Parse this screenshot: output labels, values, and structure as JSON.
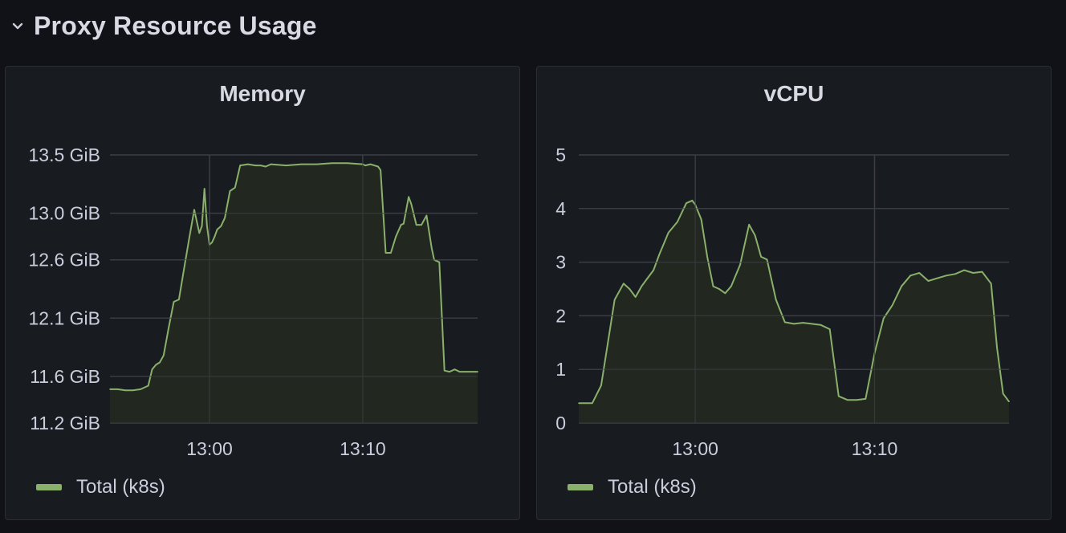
{
  "row": {
    "title": "Proxy Resource Usage",
    "icon": "chevron-down-icon"
  },
  "colors": {
    "series": "#8ab06b",
    "fill": "#242a20",
    "grid": "#3a3d44",
    "text": "#ccccdc"
  },
  "legend_label": "Total (k8s)",
  "chart_data": [
    {
      "type": "area",
      "title": "Memory",
      "ylabel": "",
      "xlabel": "",
      "unit": "GiB",
      "ylim": [
        11.2,
        13.5
      ],
      "y_ticks": [
        {
          "value": 13.5,
          "label": "13.5 GiB"
        },
        {
          "value": 13.0,
          "label": "13.0 GiB"
        },
        {
          "value": 12.6,
          "label": "12.6 GiB"
        },
        {
          "value": 12.1,
          "label": "12.1 GiB"
        },
        {
          "value": 11.6,
          "label": "11.6 GiB"
        },
        {
          "value": 11.2,
          "label": "11.2 GiB"
        }
      ],
      "xlim": [
        "12:53:30",
        "13:17:30"
      ],
      "x_ticks": [
        {
          "value": "13:00",
          "label": "13:00"
        },
        {
          "value": "13:10",
          "label": "13:10"
        }
      ],
      "grid": true,
      "legend_position": "bottom-left",
      "series": [
        {
          "name": "Total (k8s)",
          "x": [
            "12:53:30",
            "12:54:00",
            "12:54:30",
            "12:55:00",
            "12:55:30",
            "12:56:00",
            "12:56:15",
            "12:56:30",
            "12:56:45",
            "12:57:00",
            "12:57:20",
            "12:57:40",
            "12:58:00",
            "12:58:20",
            "12:58:40",
            "12:59:00",
            "12:59:20",
            "12:59:30",
            "12:59:40",
            "12:59:50",
            "13:00:00",
            "13:00:10",
            "13:00:20",
            "13:00:30",
            "13:00:45",
            "13:01:00",
            "13:01:20",
            "13:01:40",
            "13:02:00",
            "13:02:30",
            "13:03:00",
            "13:03:20",
            "13:03:40",
            "13:04:00",
            "13:05:00",
            "13:06:00",
            "13:07:00",
            "13:08:00",
            "13:09:00",
            "13:10:00",
            "13:10:10",
            "13:10:30",
            "13:11:00",
            "13:11:10",
            "13:11:30",
            "13:11:50",
            "13:12:10",
            "13:12:30",
            "13:12:40",
            "13:13:00",
            "13:13:10",
            "13:13:30",
            "13:13:50",
            "13:14:10",
            "13:14:30",
            "13:14:40",
            "13:15:00",
            "13:15:20",
            "13:15:40",
            "13:16:00",
            "13:16:20",
            "13:16:40",
            "13:17:00",
            "13:17:30"
          ],
          "values": [
            11.49,
            11.49,
            11.48,
            11.48,
            11.49,
            11.52,
            11.66,
            11.7,
            11.72,
            11.78,
            12.02,
            12.24,
            12.26,
            12.52,
            12.78,
            13.03,
            12.83,
            12.89,
            13.21,
            12.89,
            12.73,
            12.75,
            12.8,
            12.86,
            12.89,
            12.96,
            13.19,
            13.22,
            13.41,
            13.42,
            13.41,
            13.41,
            13.4,
            13.42,
            13.41,
            13.42,
            13.42,
            13.43,
            13.43,
            13.42,
            13.41,
            13.42,
            13.4,
            13.37,
            12.66,
            12.66,
            12.8,
            12.9,
            12.91,
            13.14,
            13.08,
            12.9,
            12.9,
            12.98,
            12.7,
            12.6,
            12.58,
            11.65,
            11.64,
            11.66,
            11.64,
            11.64,
            11.64,
            11.64
          ]
        }
      ]
    },
    {
      "type": "area",
      "title": "vCPU",
      "ylabel": "",
      "xlabel": "",
      "ylim": [
        0,
        5
      ],
      "y_ticks": [
        {
          "value": 5,
          "label": "5"
        },
        {
          "value": 4,
          "label": "4"
        },
        {
          "value": 3,
          "label": "3"
        },
        {
          "value": 2,
          "label": "2"
        },
        {
          "value": 1,
          "label": "1"
        },
        {
          "value": 0,
          "label": "0"
        }
      ],
      "xlim": [
        "12:53:30",
        "13:17:30"
      ],
      "x_ticks": [
        {
          "value": "13:00",
          "label": "13:00"
        },
        {
          "value": "13:10",
          "label": "13:10"
        }
      ],
      "grid": true,
      "legend_position": "bottom-left",
      "series": [
        {
          "name": "Total (k8s)",
          "x": [
            "12:53:30",
            "12:54:15",
            "12:54:45",
            "12:55:30",
            "12:56:00",
            "12:56:20",
            "12:56:40",
            "12:57:00",
            "12:57:20",
            "12:57:40",
            "12:58:00",
            "12:58:30",
            "12:59:00",
            "12:59:30",
            "12:59:50",
            "13:00:00",
            "13:00:20",
            "13:00:40",
            "13:01:00",
            "13:01:20",
            "13:01:40",
            "13:02:00",
            "13:02:30",
            "13:03:00",
            "13:03:20",
            "13:03:40",
            "13:04:00",
            "13:04:30",
            "13:05:00",
            "13:05:30",
            "13:06:00",
            "13:06:30",
            "13:07:00",
            "13:07:30",
            "13:08:00",
            "13:08:30",
            "13:09:00",
            "13:09:30",
            "13:10:00",
            "13:10:30",
            "13:11:00",
            "13:11:30",
            "13:12:00",
            "13:12:30",
            "13:13:00",
            "13:13:30",
            "13:14:00",
            "13:14:30",
            "13:15:00",
            "13:15:30",
            "13:16:00",
            "13:16:30",
            "13:16:50",
            "13:17:10",
            "13:17:30"
          ],
          "values": [
            0.37,
            0.37,
            0.7,
            2.3,
            2.6,
            2.5,
            2.35,
            2.55,
            2.7,
            2.85,
            3.15,
            3.55,
            3.75,
            4.1,
            4.15,
            4.07,
            3.8,
            3.1,
            2.55,
            2.5,
            2.42,
            2.55,
            2.95,
            3.7,
            3.5,
            3.1,
            3.05,
            2.3,
            1.88,
            1.85,
            1.87,
            1.85,
            1.83,
            1.75,
            0.5,
            0.43,
            0.43,
            0.45,
            1.3,
            1.95,
            2.2,
            2.55,
            2.75,
            2.8,
            2.65,
            2.7,
            2.75,
            2.78,
            2.85,
            2.8,
            2.82,
            2.6,
            1.4,
            0.55,
            0.4
          ]
        }
      ]
    }
  ]
}
